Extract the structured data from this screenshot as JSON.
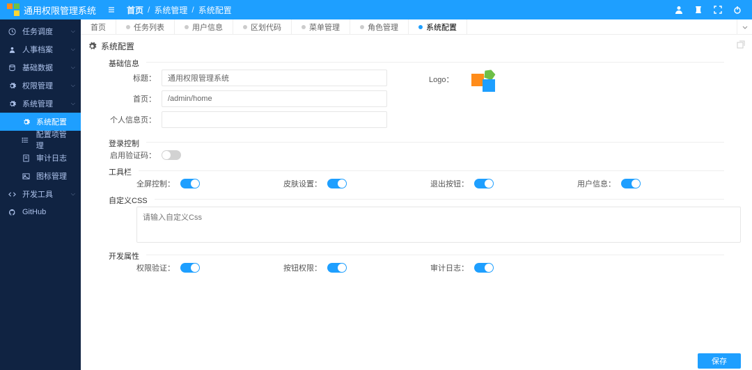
{
  "app_title": "通用权限管理系统",
  "breadcrumb": {
    "home": "首页",
    "l1": "系统管理",
    "l2": "系统配置"
  },
  "header_icons": [
    "user",
    "shirt",
    "fullscreen",
    "power"
  ],
  "sidebar": {
    "items": [
      {
        "icon": "clock",
        "label": "任务调度",
        "expandable": true
      },
      {
        "icon": "user",
        "label": "人事档案",
        "expandable": true
      },
      {
        "icon": "db",
        "label": "基础数据",
        "expandable": true
      },
      {
        "icon": "gear",
        "label": "权限管理",
        "expandable": true
      },
      {
        "icon": "gear",
        "label": "系统管理",
        "expandable": true,
        "expanded": true
      },
      {
        "icon": "gear",
        "label": "系统配置",
        "sub": true,
        "active": true
      },
      {
        "icon": "list",
        "label": "配置项管理",
        "sub": true
      },
      {
        "icon": "doc",
        "label": "审计日志",
        "sub": true
      },
      {
        "icon": "img",
        "label": "图标管理",
        "sub": true
      },
      {
        "icon": "code",
        "label": "开发工具",
        "expandable": true
      },
      {
        "icon": "github",
        "label": "GitHub"
      }
    ]
  },
  "tabs": [
    "首页",
    "任务列表",
    "用户信息",
    "区划代码",
    "菜单管理",
    "角色管理",
    "系统配置"
  ],
  "active_tab_index": 6,
  "card_title": "系统配置",
  "basic": {
    "legend": "基础信息",
    "title_label": "标题：",
    "title_value": "通用权限管理系统",
    "home_label": "首页：",
    "home_value": "/admin/home",
    "profile_label": "个人信息页：",
    "profile_value": "",
    "logo_label": "Logo："
  },
  "login": {
    "legend": "登录控制",
    "captcha_label": "启用验证码：",
    "captcha_on": false
  },
  "toolbar": {
    "legend": "工具栏",
    "fullscreen_label": "全屏控制：",
    "skin_label": "皮肤设置：",
    "logout_label": "退出按钮：",
    "userinfo_label": "用户信息："
  },
  "css": {
    "legend": "自定义CSS",
    "placeholder": "请输入自定义Css"
  },
  "dev": {
    "legend": "开发属性",
    "auth_label": "权限验证：",
    "btnauth_label": "按钮权限：",
    "audit_label": "审计日志："
  },
  "save_label": "保存"
}
